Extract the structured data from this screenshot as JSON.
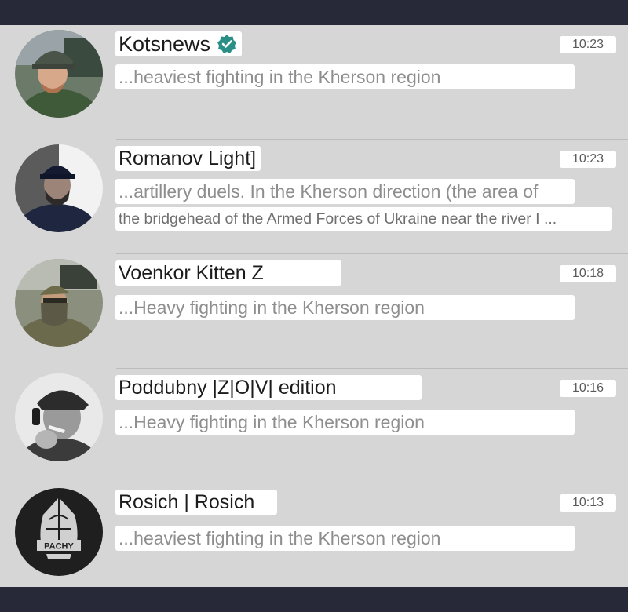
{
  "chats": [
    {
      "name": "Kotsnews",
      "verified": true,
      "time": "10:23",
      "preview": [
        "...heaviest fighting in the Kherson region"
      ],
      "avatar_icon": "soldier-helmet-photo"
    },
    {
      "name": "Romanov Light]",
      "time": "10:23",
      "preview": [
        "...artillery duels. In the Kherson direction (the area of",
        "the bridgehead of the Armed Forces of Ukraine near the river I ..."
      ],
      "avatar_icon": "man-cap-photo"
    },
    {
      "name": "Voenkor Kitten Z",
      "time": "10:18",
      "preview": [
        "...Heavy fighting in the Kherson region"
      ],
      "avatar_icon": "masked-soldier-photo"
    },
    {
      "name": "Poddubny |Z|O|V| edition",
      "time": "10:16",
      "preview": [
        "...Heavy fighting in the Kherson region"
      ],
      "avatar_icon": "smoking-man-photo"
    },
    {
      "name": "Rosich | Rosich",
      "time": "10:13",
      "preview": [
        "...heaviest fighting in the Kherson region"
      ],
      "avatar_icon": "helmet-logo",
      "avatar_text": "PACHY"
    }
  ],
  "colors": {
    "frame": "#272838",
    "list_background": "#d6d6d6",
    "verified_badge": "#2a8f86"
  }
}
